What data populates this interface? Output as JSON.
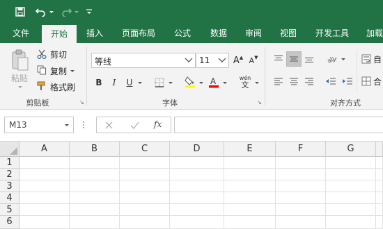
{
  "quick_access": {
    "save_icon": "save-icon",
    "undo_icon": "undo-icon",
    "redo_icon": "redo-icon",
    "customize_icon": "customize-qat-icon"
  },
  "tabs": [
    {
      "label": "文件"
    },
    {
      "label": "开始"
    },
    {
      "label": "插入"
    },
    {
      "label": "页面布局"
    },
    {
      "label": "公式"
    },
    {
      "label": "数据"
    },
    {
      "label": "审阅"
    },
    {
      "label": "视图"
    },
    {
      "label": "开发工具"
    },
    {
      "label": "加载"
    }
  ],
  "clipboard": {
    "paste_label": "粘贴",
    "cut_label": "剪切",
    "copy_label": "复制",
    "format_painter_label": "格式刷",
    "group_label": "剪贴板"
  },
  "font": {
    "font_name": "等线",
    "font_size": "11",
    "grow_label": "A",
    "shrink_label": "A",
    "bold_label": "B",
    "italic_label": "I",
    "underline_label": "U",
    "phonetic_label": "wén",
    "group_label": "字体"
  },
  "alignment": {
    "wrap_label": "自",
    "merge_label": "合",
    "group_label": "对齐方式"
  },
  "formula_bar": {
    "name_box": "M13",
    "fx_label": "fx",
    "formula_value": ""
  },
  "grid": {
    "columns": [
      "A",
      "B",
      "C",
      "D",
      "E",
      "F",
      "G"
    ],
    "rows": [
      "1",
      "2",
      "3",
      "4",
      "5",
      "6"
    ]
  },
  "colors": {
    "brand": "#217346",
    "highlight_fill": "#ffff00",
    "font_color": "#ff0000"
  }
}
